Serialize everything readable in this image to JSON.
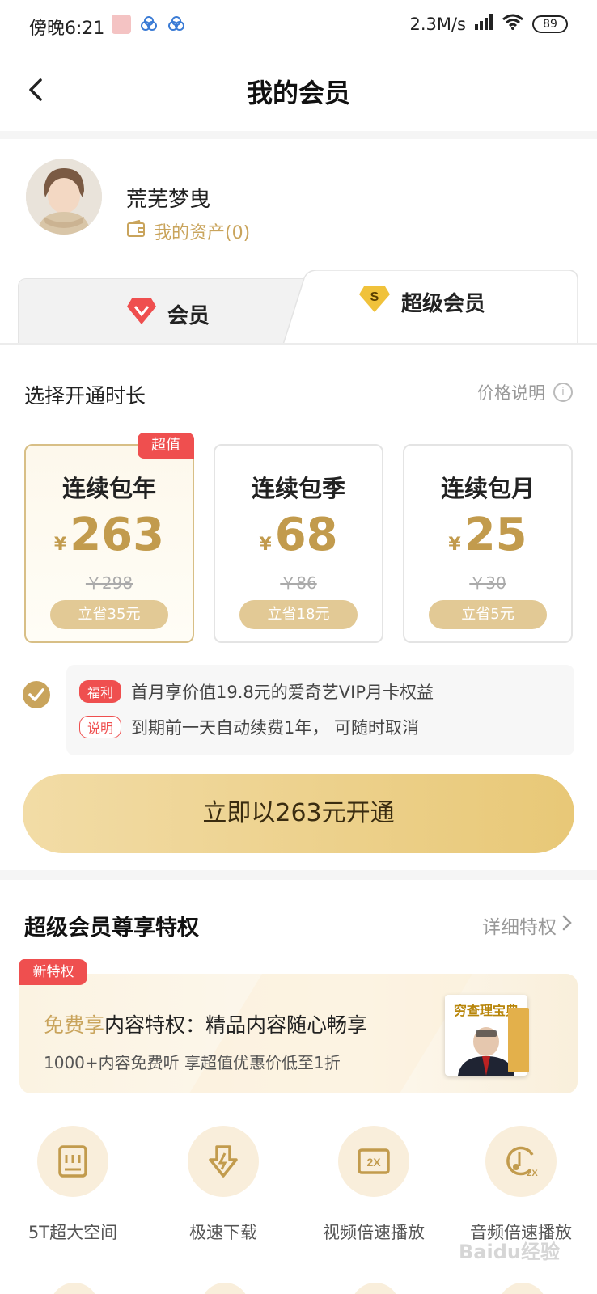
{
  "status_bar": {
    "time": "傍晚6:21",
    "network": "2.3M/s",
    "battery": "89"
  },
  "header": {
    "title": "我的会员"
  },
  "profile": {
    "name": "荒芜梦曳",
    "assets_label": "我的资产(0)"
  },
  "tabs": [
    {
      "label": "会员",
      "active": false
    },
    {
      "label": "超级会员",
      "active": true
    }
  ],
  "duration": {
    "title": "选择开通时长",
    "price_info_label": "价格说明",
    "plans": [
      {
        "badge": "超值",
        "name": "连续包年",
        "currency": "¥",
        "price": "263",
        "original": "￥298",
        "save": "立省35元",
        "selected": true
      },
      {
        "badge": "",
        "name": "连续包季",
        "currency": "¥",
        "price": "68",
        "original": "￥86",
        "save": "立省18元",
        "selected": false
      },
      {
        "badge": "",
        "name": "连续包月",
        "currency": "¥",
        "price": "25",
        "original": "￥30",
        "save": "立省5元",
        "selected": false
      }
    ]
  },
  "benefit": {
    "tag1": "福利",
    "line1": "首月享价值19.8元的爱奇艺VIP月卡权益",
    "tag2": "说明",
    "line2": "到期前一天自动续费1年， 可随时取消"
  },
  "cta": {
    "label": "立即以263元开通"
  },
  "privileges": {
    "title": "超级会员尊享特权",
    "detail_label": "详细特权",
    "promo": {
      "badge": "新特权",
      "highlight": "免费享",
      "main": "内容特权：精品内容随心畅享",
      "sub": "1000+内容免费听  享超值优惠价低至1折",
      "book_title": "穷查理宝典"
    },
    "features": [
      {
        "label": "5T超大空间",
        "icon": "storage-icon"
      },
      {
        "label": "极速下载",
        "icon": "fast-download-icon"
      },
      {
        "label": "视频倍速播放",
        "icon": "video-speed-icon"
      },
      {
        "label": "音频倍速播放",
        "icon": "audio-speed-icon"
      }
    ]
  },
  "watermark": "Baidu经验",
  "colors": {
    "gold": "#c9a45c",
    "red": "#ef4f4f",
    "cta": "#e8c877"
  }
}
